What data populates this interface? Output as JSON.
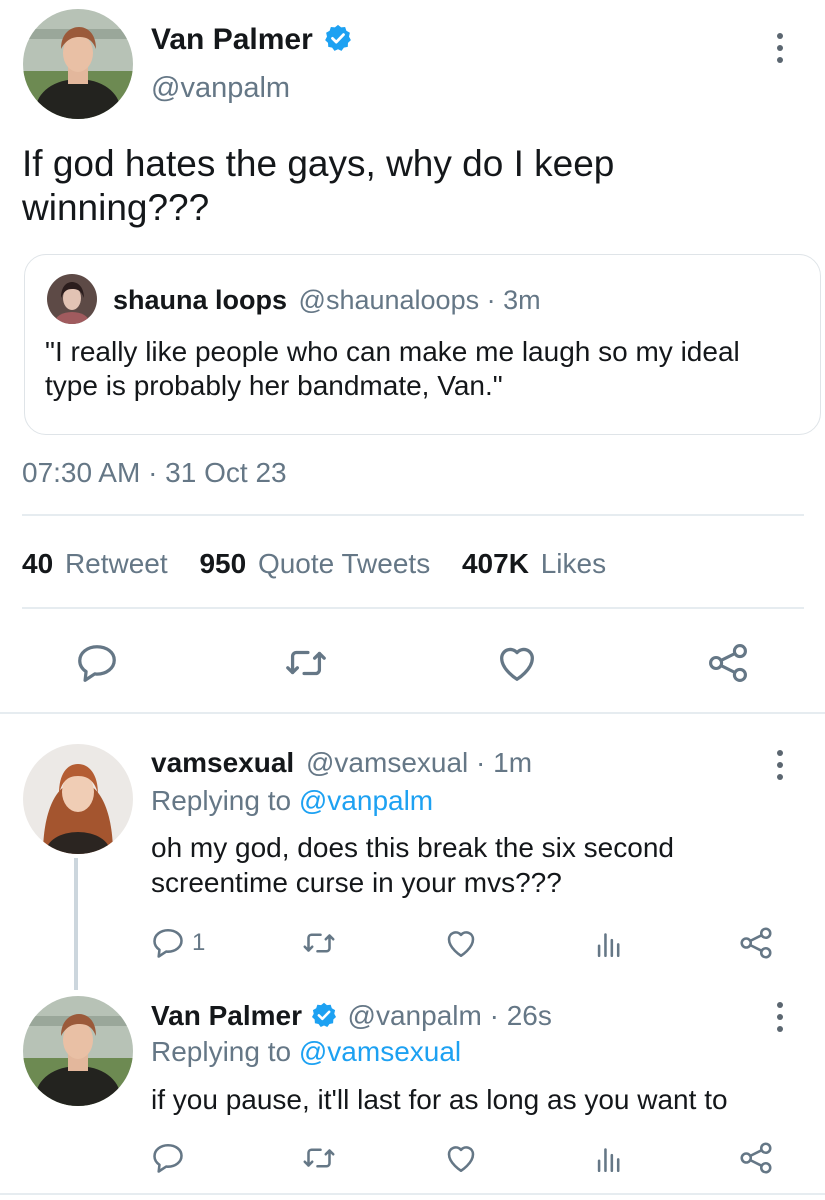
{
  "main_tweet": {
    "author_name": "Van Palmer",
    "handle": "@vanpalm",
    "text": "If god hates the gays, why do I keep winning???",
    "quote": {
      "author_name": "shauna loops",
      "handle_time": "@shaunaloops · 3m",
      "text": "\"I really like people who can make me laugh so my ideal type is probably her bandmate, Van.\""
    },
    "timestamp": "07:30 AM · 31 Oct 23",
    "stats": {
      "retweets_count": "40",
      "retweets_label": "Retweet",
      "quotes_count": "950",
      "quotes_label": "Quote Tweets",
      "likes_count": "407K",
      "likes_label": "Likes"
    }
  },
  "replies": [
    {
      "author_name": "vamsexual",
      "handle_time": "@vamsexual · 1m",
      "replying_prefix": "Replying to",
      "replying_to": "@vanpalm",
      "text": "oh my god, does this break the six second screentime curse in your mvs???",
      "reply_count": "1"
    },
    {
      "author_name": "Van Palmer",
      "handle_time": "@vanpalm · 26s",
      "replying_prefix": "Replying to",
      "replying_to": "@vamsexual",
      "text": "if you pause, it'll last for as long as you want to",
      "reply_count": ""
    }
  ],
  "icons": {
    "reply": "speech-bubble-icon",
    "retweet": "retweet-arrows-icon",
    "like": "heart-icon",
    "share": "share-nodes-icon",
    "analytics": "bar-chart-icon",
    "more": "vertical-ellipsis-icon",
    "verified": "verified-badge-icon"
  },
  "colors": {
    "accent": "#1da1f2",
    "muted": "#657786",
    "text": "#14171a",
    "divider": "#e6ecf0"
  }
}
